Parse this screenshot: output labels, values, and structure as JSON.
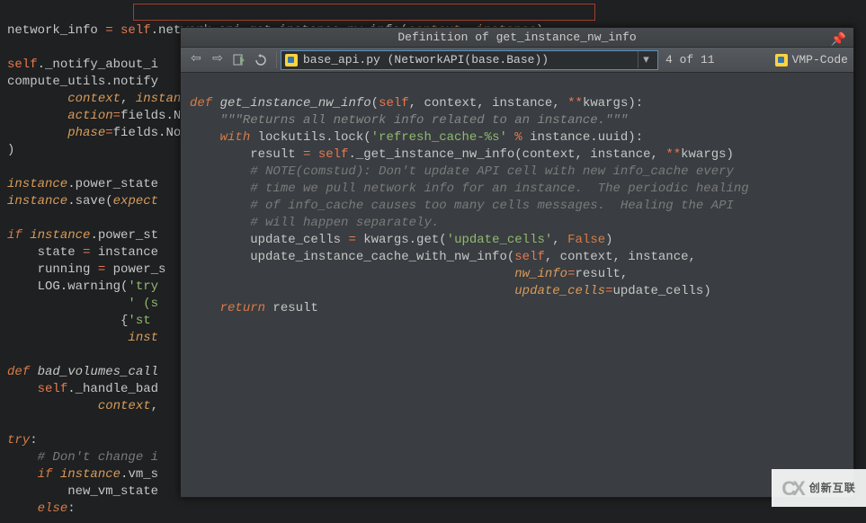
{
  "bg": {
    "l1a": "network_info ",
    "l1b": "=",
    "l1c": " ",
    "l1d": "self",
    "l1e": ".network_api.get_instance_nw_info(",
    "l1f": "context",
    "l1g": ", ",
    "l1h": "instance",
    "l1i": ")",
    "l2a": "self",
    "l2b": "._notify_about_i",
    "l3a": "compute_utils.notify",
    "l4a": "        ",
    "l4b": "context",
    "l4c": ", ",
    "l4d": "instanc",
    "l5a": "        ",
    "l5b": "action",
    "l5c": "=",
    "l5d": "fields.No",
    "l6a": "        ",
    "l6b": "phase",
    "l6c": "=",
    "l6d": "fields.Not",
    "l7a": ")",
    "l8a": "instance",
    "l8b": ".power_state",
    "l9a": "instance",
    "l9b": ".save(",
    "l9c": "expect",
    "l10a": "if",
    "l10b": " ",
    "l10c": "instance",
    "l10d": ".power_st",
    "l11a": "    state ",
    "l11b": "=",
    "l11c": " instance",
    "l12a": "    running ",
    "l12b": "=",
    "l12c": " power_s",
    "l13a": "    LOG.warning(",
    "l13b": "'try",
    "l14a": "                ",
    "l14b": "' (s",
    "l15a": "               {",
    "l15b": "'st",
    "l16a": "                ",
    "l16b": "inst",
    "l17a": "def",
    "l17b": " ",
    "l17c": "bad_volumes_call",
    "l18a": "    ",
    "l18b": "self",
    "l18c": "._handle_bad",
    "l19a": "            ",
    "l19b": "context",
    "l19c": ",",
    "l20a": "try",
    "l20b": ":",
    "l21a": "    ",
    "l21b": "# Don't change i",
    "l22a": "    ",
    "l22b": "if",
    "l22c": " ",
    "l22d": "instance",
    "l22e": ".vm_s",
    "l23a": "        new_vm_state",
    "l24a": "    ",
    "l24b": "else",
    "l24c": ":"
  },
  "popup": {
    "title": "Definition of get_instance_nw_info",
    "file": "base_api.py (NetworkAPI(base.Base))",
    "counter": "4 of 11",
    "project": "VMP-Code"
  },
  "pc": {
    "l1": {
      "a": "def",
      "b": " ",
      "c": "get_instance_nw_info",
      "d": "(",
      "e": "self",
      "f": ", ",
      "g": "context",
      "h": ", ",
      "i": "instance",
      "j": ", ",
      "k": "**",
      "l": "kwargs",
      "m": "):"
    },
    "l2": {
      "a": "    ",
      "b": "\"\"\"Returns all network info related to an instance.\"\"\""
    },
    "l3": {
      "a": "    ",
      "b": "with",
      "c": " lockutils.lock(",
      "d": "'refresh_cache-%s'",
      "e": " ",
      "f": "%",
      "g": " instance.uuid):"
    },
    "l4": {
      "a": "        result ",
      "b": "=",
      "c": " ",
      "d": "self",
      "e": "._get_instance_nw_info(context, instance, ",
      "f": "**",
      "g": "kwargs)"
    },
    "l5": {
      "a": "        ",
      "b": "# NOTE(comstud): Don't update API cell with new info_cache every"
    },
    "l6": {
      "a": "        ",
      "b": "# time we pull network info for an instance.  The periodic healing"
    },
    "l7": {
      "a": "        ",
      "b": "# of info_cache causes too many cells messages.  Healing the API"
    },
    "l8": {
      "a": "        ",
      "b": "# will happen separately."
    },
    "l9": {
      "a": "        update_cells ",
      "b": "=",
      "c": " kwargs.get(",
      "d": "'update_cells'",
      "e": ", ",
      "f": "False",
      "g": ")"
    },
    "l10": {
      "a": "        update_instance_cache_with_nw_info(",
      "b": "self",
      "c": ", context, instance,"
    },
    "l11": {
      "a": "                                           ",
      "b": "nw_info",
      "c": "=",
      "d": "result,"
    },
    "l12": {
      "a": "                                           ",
      "b": "update_cells",
      "c": "=",
      "d": "update_cells)"
    },
    "l13": {
      "a": "    ",
      "b": "return",
      "c": " result"
    }
  },
  "watermark": {
    "brand": "创新互联"
  }
}
